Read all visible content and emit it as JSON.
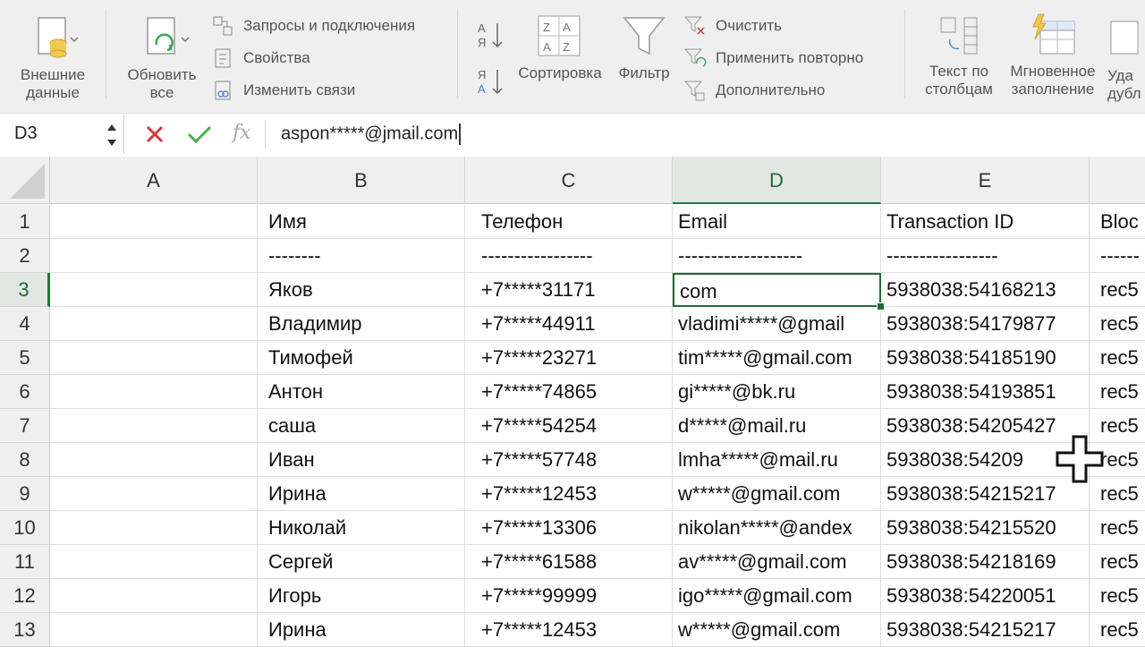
{
  "ribbon": {
    "external_data": "Внешние\nданные",
    "refresh_all": "Обновить\nвсе",
    "queries_connections": "Запросы и подключения",
    "properties": "Свойства",
    "edit_links": "Изменить связи",
    "sort_az": "А\nЯ",
    "sort_za": "Я\nА",
    "sort": "Сортировка",
    "filter": "Фильтр",
    "clear": "Очистить",
    "reapply": "Применить повторно",
    "advanced": "Дополнительно",
    "text_to_columns": "Текст по\nстолбцам",
    "flash_fill": "Мгновенное\nзаполнение",
    "remove_duplicates": "Уда\nдубл",
    "sort_icon_letters": [
      "Я",
      "А",
      "А",
      "Я"
    ]
  },
  "formula_bar": {
    "name_box": "D3",
    "fx": "fx",
    "content": "aspon*****@jmail.com"
  },
  "columns": [
    "A",
    "B",
    "C",
    "D",
    "E"
  ],
  "extra_column_header": "",
  "rows": [
    {
      "n": "1",
      "a": "",
      "b": "Имя",
      "c": "Телефон",
      "d": "Email",
      "e": "Transaction ID",
      "f": "Bloc"
    },
    {
      "n": "2",
      "a": "",
      "b": "--------",
      "c": "-----------------",
      "d": "-------------------",
      "e": "-----------------",
      "f": "------"
    },
    {
      "n": "3",
      "a": "",
      "b": "Яков",
      "c": "+7*****31171",
      "d": "com",
      "e": "5938038:54168213",
      "f": "rec5"
    },
    {
      "n": "4",
      "a": "",
      "b": "Владимир",
      "c": "+7*****44911",
      "d": "vladimi*****@gmail",
      "e": "5938038:54179877",
      "f": "rec5"
    },
    {
      "n": "5",
      "a": "",
      "b": "Тимофей",
      "c": "+7*****23271",
      "d": "tim*****@gmail.com",
      "e": "5938038:54185190",
      "f": "rec5"
    },
    {
      "n": "6",
      "a": "",
      "b": "Антон",
      "c": "+7*****74865",
      "d": "gi*****@bk.ru",
      "e": "5938038:54193851",
      "f": "rec5"
    },
    {
      "n": "7",
      "a": "",
      "b": "саша",
      "c": "+7*****54254",
      "d": "d*****@mail.ru",
      "e": "5938038:54205427",
      "f": "rec5"
    },
    {
      "n": "8",
      "a": "",
      "b": "Иван",
      "c": "+7*****57748",
      "d": "lmha*****@mail.ru",
      "e": "5938038:54209",
      "f": "rec5"
    },
    {
      "n": "9",
      "a": "",
      "b": "Ирина",
      "c": "+7*****12453",
      "d": "w*****@gmail.com",
      "e": "5938038:54215217",
      "f": "rec5"
    },
    {
      "n": "10",
      "a": "",
      "b": "Николай",
      "c": "+7*****13306",
      "d": "nikolan*****@andex",
      "e": "5938038:54215520",
      "f": "rec5"
    },
    {
      "n": "11",
      "a": "",
      "b": "Сергей",
      "c": "+7*****61588",
      "d": "av*****@gmail.com",
      "e": "5938038:54218169",
      "f": "rec5"
    },
    {
      "n": "12",
      "a": "",
      "b": "Игорь",
      "c": "+7*****99999",
      "d": "igo*****@gmail.com",
      "e": "5938038:54220051",
      "f": "rec5"
    },
    {
      "n": "13",
      "a": "",
      "b": "Ирина",
      "c": "+7*****12453",
      "d": "w*****@gmail.com",
      "e": "5938038:54215217",
      "f": "rec5"
    }
  ],
  "colors": {
    "accent": "#1f6b35",
    "cancel": "#d23b3b",
    "confirm": "#4caf50"
  }
}
